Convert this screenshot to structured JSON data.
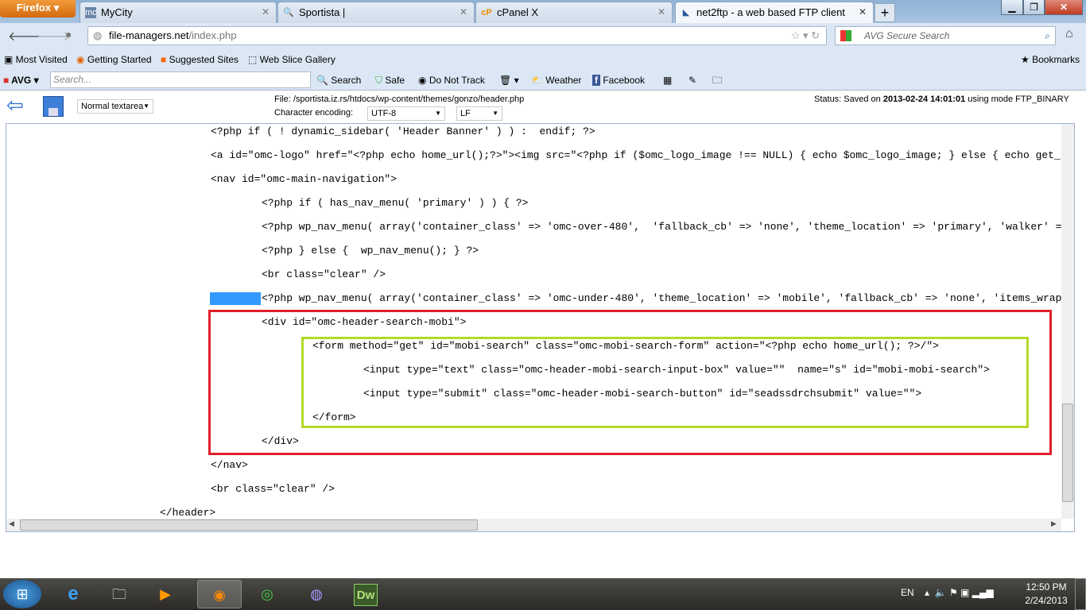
{
  "browser": {
    "menu_button": "Firefox",
    "tabs": [
      {
        "title": "MyCity",
        "icon": "mc"
      },
      {
        "title": "Sportista |",
        "icon": "search"
      },
      {
        "title": "cPanel X",
        "icon": "cP"
      },
      {
        "title": "net2ftp - a web based FTP client",
        "icon": "net2ftp"
      }
    ],
    "url_host": "file-managers.net",
    "url_path": "/index.php",
    "search_placeholder": "AVG Secure Search",
    "bookmarks": [
      "Most Visited",
      "Getting Started",
      "Suggested Sites",
      "Web Slice Gallery"
    ],
    "bookmarks_menu": "Bookmarks",
    "avg_toolbar": {
      "logo": "AVG",
      "search_placeholder": "Search...",
      "search_button": "Search",
      "safe": "Safe",
      "do_not_track": "Do Not Track",
      "weather": "Weather",
      "facebook": "Facebook"
    }
  },
  "editor_app": {
    "mode_select": "Normal textarea",
    "file_label": "File: /sportista.iz.rs/htdocs/wp-content/themes/gonzo/header.php",
    "encoding_label": "Character encoding:",
    "encoding_value": "UTF-8",
    "line_ending": "LF",
    "status_prefix": "Status: Saved on ",
    "status_time": "2013-02-24 14:01:01",
    "status_suffix": " using mode FTP_BINARY"
  },
  "code_lines": [
    {
      "indent": 1,
      "text": "<?php if ( ! dynamic_sidebar( 'Header Banner' ) ) :  endif; ?>"
    },
    {
      "indent": 1,
      "text": "<a id=\"omc-logo\" href=\"<?php echo home_url();?>\"><img src=\"<?php if ($omc_logo_image !== NULL) { echo $omc_logo_image; } else { echo get_template_directory_uri()"
    },
    {
      "indent": 1,
      "text": "<nav id=\"omc-main-navigation\">"
    },
    {
      "indent": 2,
      "text": "<?php if ( has_nav_menu( 'primary' ) ) { ?>"
    },
    {
      "indent": 2,
      "text": "<?php wp_nav_menu( array('container_class' => 'omc-over-480',  'fallback_cb' => 'none', 'theme_location' => 'primary', 'walker' => new"
    },
    {
      "indent": 2,
      "text": "<?php } else {  wp_nav_menu(); } ?>"
    },
    {
      "indent": 2,
      "text": "<br class=\"clear\" />"
    },
    {
      "indent": 2,
      "text": "<?php wp_nav_menu( array('container_class' => 'omc-under-480', 'theme_location' => 'mobile', 'fallback_cb' => 'none', 'items_wrap' => '"
    },
    {
      "indent": 2,
      "text": "<div id=\"omc-header-search-mobi\">"
    },
    {
      "indent": 3,
      "text": "<form method=\"get\" id=\"mobi-search\" class=\"omc-mobi-search-form\" action=\"<?php echo home_url(); ?>/\">"
    },
    {
      "indent": 4,
      "text": "<input type=\"text\" class=\"omc-header-mobi-search-input-box\" value=\"\"  name=\"s\" id=\"mobi-mobi-search\">"
    },
    {
      "indent": 4,
      "text": "<input type=\"submit\" class=\"omc-header-mobi-search-button\" id=\"seadssdrchsubmit\" value=\"\">"
    },
    {
      "indent": 3,
      "text": "</form>"
    },
    {
      "indent": 2,
      "text": "</div>"
    },
    {
      "indent": 1,
      "text": "</nav>"
    },
    {
      "indent": 1,
      "text": "<br class=\"clear\" />"
    },
    {
      "indent": 0,
      "text": "</header>"
    }
  ],
  "annotations": {
    "red_box_color": "#e0202a",
    "green_box_color": "#b5d92a"
  },
  "taskbar": {
    "language": "EN",
    "time": "12:50 PM",
    "date": "2/24/2013",
    "apps": [
      "Internet Explorer",
      "Windows Explorer",
      "Media Player",
      "Firefox",
      "Chrome",
      "BitTorrent",
      "Dreamweaver"
    ],
    "dw_label": "Dw"
  }
}
